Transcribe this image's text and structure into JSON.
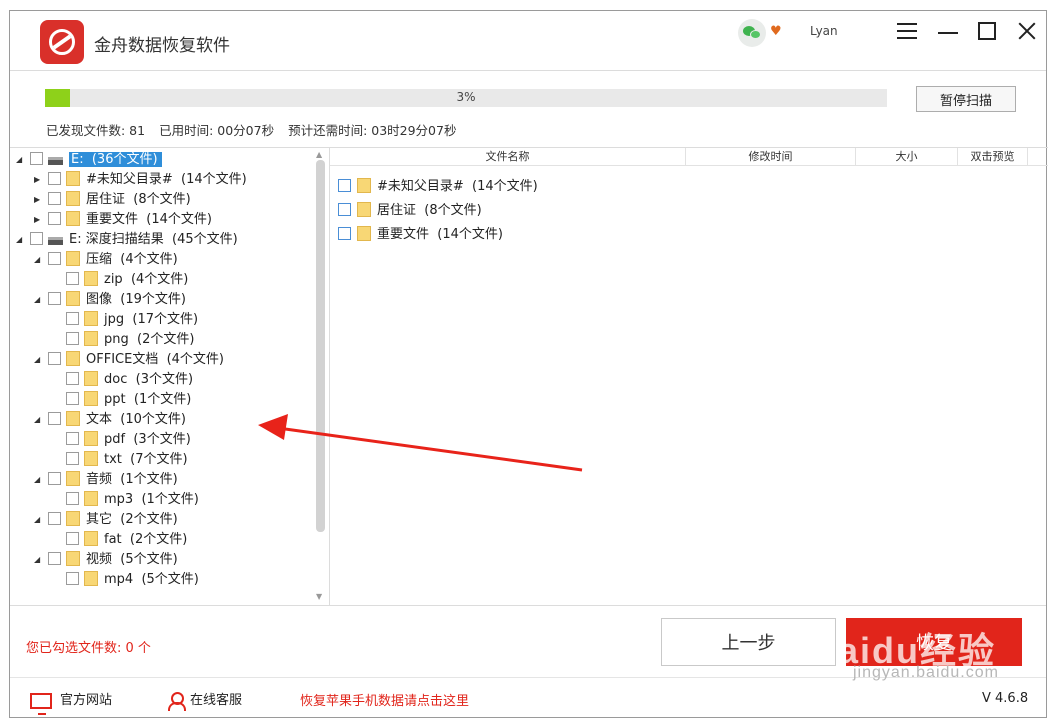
{
  "app": {
    "title": "金舟数据恢复软件",
    "user": "Lyan",
    "vip_badge": "♥"
  },
  "progress": {
    "percent": 3,
    "label": "3%",
    "pause_button": "暂停扫描"
  },
  "stats": {
    "found": "已发现文件数: 81",
    "elapsed": "已用时间: 00分07秒",
    "remaining": "预计还需时间: 03时29分07秒"
  },
  "tree": [
    {
      "label": "E:",
      "count": "(36个文件)",
      "level": 0,
      "expanded": true,
      "type": "drive",
      "selected": true
    },
    {
      "label": "#未知父目录#",
      "count": "(14个文件)",
      "level": 1,
      "expanded": false,
      "type": "folder"
    },
    {
      "label": "居住证",
      "count": "(8个文件)",
      "level": 1,
      "expanded": false,
      "type": "folder"
    },
    {
      "label": "重要文件",
      "count": "(14个文件)",
      "level": 1,
      "expanded": false,
      "type": "folder"
    },
    {
      "label": "E: 深度扫描结果",
      "count": "(45个文件)",
      "level": 0,
      "expanded": true,
      "type": "drive"
    },
    {
      "label": "压缩",
      "count": "(4个文件)",
      "level": 1,
      "expanded": true,
      "type": "folder"
    },
    {
      "label": "zip",
      "count": "(4个文件)",
      "level": 2,
      "type": "folder"
    },
    {
      "label": "图像",
      "count": "(19个文件)",
      "level": 1,
      "expanded": true,
      "type": "folder"
    },
    {
      "label": "jpg",
      "count": "(17个文件)",
      "level": 2,
      "type": "folder"
    },
    {
      "label": "png",
      "count": "(2个文件)",
      "level": 2,
      "type": "folder"
    },
    {
      "label": "OFFICE文档",
      "count": "(4个文件)",
      "level": 1,
      "expanded": true,
      "type": "folder"
    },
    {
      "label": "doc",
      "count": "(3个文件)",
      "level": 2,
      "type": "folder"
    },
    {
      "label": "ppt",
      "count": "(1个文件)",
      "level": 2,
      "type": "folder"
    },
    {
      "label": "文本",
      "count": "(10个文件)",
      "level": 1,
      "expanded": true,
      "type": "folder"
    },
    {
      "label": "pdf",
      "count": "(3个文件)",
      "level": 2,
      "type": "folder"
    },
    {
      "label": "txt",
      "count": "(7个文件)",
      "level": 2,
      "type": "folder"
    },
    {
      "label": "音频",
      "count": "(1个文件)",
      "level": 1,
      "expanded": true,
      "type": "folder"
    },
    {
      "label": "mp3",
      "count": "(1个文件)",
      "level": 2,
      "type": "folder"
    },
    {
      "label": "其它",
      "count": "(2个文件)",
      "level": 1,
      "expanded": true,
      "type": "folder"
    },
    {
      "label": "fat",
      "count": "(2个文件)",
      "level": 2,
      "type": "folder"
    },
    {
      "label": "视频",
      "count": "(5个文件)",
      "level": 1,
      "expanded": true,
      "type": "folder"
    },
    {
      "label": "mp4",
      "count": "(5个文件)",
      "level": 2,
      "type": "folder"
    }
  ],
  "list": {
    "columns": [
      "文件名称",
      "修改时间",
      "大小",
      "双击预览"
    ],
    "rows": [
      {
        "name": "#未知父目录#",
        "count": "(14个文件)"
      },
      {
        "name": "居住证",
        "count": "(8个文件)"
      },
      {
        "name": "重要文件",
        "count": "(14个文件)"
      }
    ]
  },
  "footer": {
    "selected_count": "您已勾选文件数: 0 个",
    "prev_button": "上一步",
    "recover_button": "恢复",
    "site_link": "官方网站",
    "service_link": "在线客服",
    "apple_link": "恢复苹果手机数据请点击这里",
    "version": "V 4.6.8"
  },
  "watermark": {
    "brand": "Baidu经验",
    "url": "jingyan.baidu.com"
  },
  "colors": {
    "accent": "#e1251b",
    "progress": "#8ed11a",
    "selection": "#2f8ed9",
    "annotation_arrow": "#e8231a"
  }
}
